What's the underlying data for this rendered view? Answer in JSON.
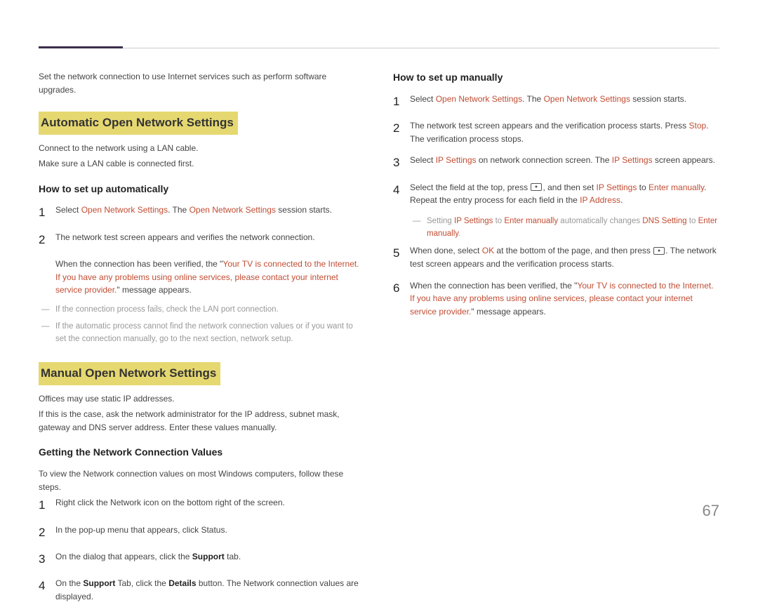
{
  "pageNumber": "67",
  "left": {
    "intro": "Set the network connection to use Internet services such as perform software upgrades.",
    "section1": {
      "heading": "Automatic Open Network Settings",
      "p1": "Connect to the network using a LAN cable.",
      "p2": "Make sure a LAN cable is connected first.",
      "sub": "How to set up automatically",
      "step1_a": "Select ",
      "step1_b": "Open Network Settings",
      "step1_c": ". The ",
      "step1_d": "Open Network Settings",
      "step1_e": " session starts.",
      "step2": "The network test screen appears and verifies the network connection.",
      "verified_a": "When the connection has been verified, the \"",
      "verified_b": "Your TV is connected to the Internet. If you have any problems using online services, please contact your internet service provider.",
      "verified_c": "\" message appears.",
      "note1": "If the connection process fails, check the LAN port connection.",
      "note2": "If the automatic process cannot find the network connection values or if you want to set the connection manually, go to the next section, network setup."
    },
    "section2": {
      "heading": "Manual Open Network Settings",
      "p1": "Offices may use static IP addresses.",
      "p2": "If this is the case, ask the network administrator for the IP address, subnet mask, gateway and DNS server address. Enter these values manually.",
      "sub": "Getting the Network Connection Values",
      "intro2": "To view the Network connection values on most Windows computers, follow these steps.",
      "s1": "Right click the Network icon on the bottom right of the screen.",
      "s2": "In the pop-up menu that appears, click Status.",
      "s3_a": "On the dialog that appears, click the ",
      "s3_b": "Support",
      "s3_c": " tab.",
      "s4_a": "On the ",
      "s4_b": "Support",
      "s4_c": " Tab, click the ",
      "s4_d": "Details",
      "s4_e": " button. The Network connection values are displayed."
    }
  },
  "right": {
    "sub": "How to set up manually",
    "s1_a": "Select ",
    "s1_b": "Open Network Settings",
    "s1_c": ". The ",
    "s1_d": "Open Network Settings",
    "s1_e": " session starts.",
    "s2_a": "The network test screen appears and the verification process starts. Press ",
    "s2_b": "Stop",
    "s2_c": ". The verification process stops.",
    "s3_a": "Select ",
    "s3_b": "IP Settings",
    "s3_c": " on network connection screen. The ",
    "s3_d": "IP Settings",
    "s3_e": " screen appears.",
    "s4_a": "Select the field at the top, press ",
    "s4_b": ", and then set ",
    "s4_c": "IP Settings",
    "s4_d": " to ",
    "s4_e": "Enter manually",
    "s4_f": ". Repeat the entry process for each field in the ",
    "s4_g": "IP Address",
    "s4_h": ".",
    "note_a": "Setting ",
    "note_b": "IP Settings",
    "note_c": " to ",
    "note_d": "Enter manually",
    "note_e": " automatically changes ",
    "note_f": "DNS Setting",
    "note_g": " to ",
    "note_h": "Enter manually",
    "note_i": ".",
    "s5_a": "When done, select ",
    "s5_b": "OK",
    "s5_c": " at the bottom of the page, and then press ",
    "s5_d": ". The network test screen appears and the verification process starts.",
    "s6_a": "When the connection has been verified, the \"",
    "s6_b": "Your TV is connected to the Internet. If you have any problems using online services, please contact your internet service provider.",
    "s6_c": "\" message appears."
  }
}
